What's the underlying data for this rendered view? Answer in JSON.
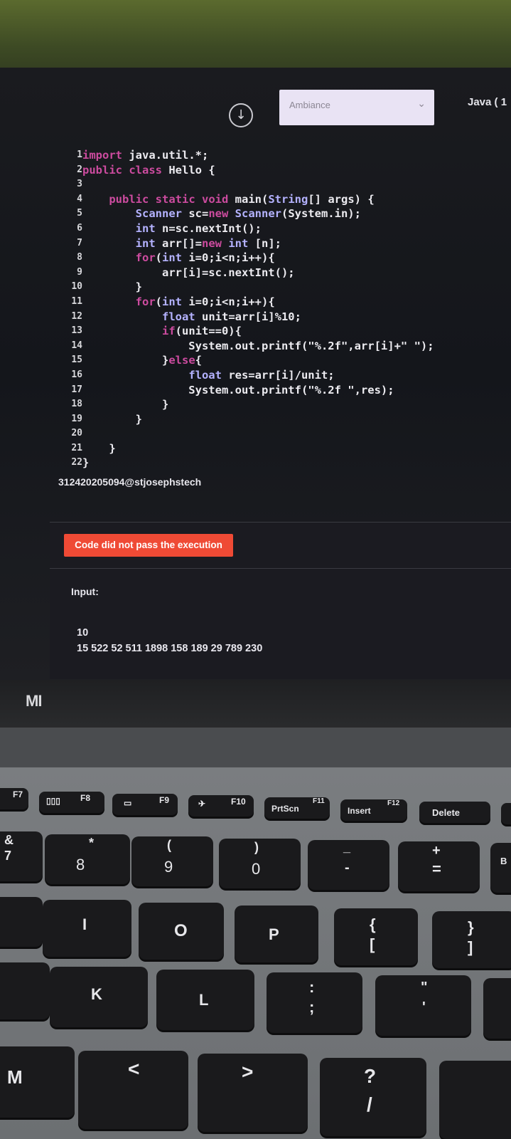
{
  "toolbar": {
    "theme_select_value": "Ambiance",
    "language_label": "Java ( 1"
  },
  "editor": {
    "lines": [
      {
        "n": "1",
        "text": "import java.util.*;"
      },
      {
        "n": "2",
        "text": "public class Hello {"
      },
      {
        "n": "3",
        "text": ""
      },
      {
        "n": "4",
        "text": "    public static void main(String[] args) {"
      },
      {
        "n": "5",
        "text": "        Scanner sc=new Scanner(System.in);"
      },
      {
        "n": "6",
        "text": "        int n=sc.nextInt();"
      },
      {
        "n": "7",
        "text": "        int arr[]=new int [n];"
      },
      {
        "n": "8",
        "text": "        for(int i=0;i<n;i++){"
      },
      {
        "n": "9",
        "text": "            arr[i]=sc.nextInt();"
      },
      {
        "n": "10",
        "text": "        }"
      },
      {
        "n": "11",
        "text": "        for(int i=0;i<n;i++){"
      },
      {
        "n": "12",
        "text": "            float unit=arr[i]%10;"
      },
      {
        "n": "13",
        "text": "            if(unit==0){"
      },
      {
        "n": "14",
        "text": "                System.out.printf(\"%.2f\",arr[i]+\" \");"
      },
      {
        "n": "15",
        "text": "            }else{"
      },
      {
        "n": "16",
        "text": "                float res=arr[i]/unit;"
      },
      {
        "n": "17",
        "text": "                System.out.printf(\"%.2f \",res);"
      },
      {
        "n": "18",
        "text": "            }"
      },
      {
        "n": "19",
        "text": "        }"
      },
      {
        "n": "20",
        "text": ""
      },
      {
        "n": "21",
        "text": "    }"
      },
      {
        "n": "22",
        "text": "}"
      }
    ],
    "cursor_glyph": "I"
  },
  "author": "312420205094@stjosephstech",
  "result": {
    "status_badge": "Code did not pass the execution",
    "input_label": "Input:",
    "input_lines": [
      "10",
      "15 522 52 511 1898 158 189 29 789 230"
    ]
  },
  "laptop": {
    "logo": "MI",
    "keys": {
      "f7": "F7",
      "f8": "F8",
      "f9": "F9",
      "f10": "F10",
      "f11": "F11",
      "f12": "F12",
      "prtscn": "PrtScn",
      "insert": "Insert",
      "delete": "Delete",
      "k8_top": "*",
      "k8_bottom": "8",
      "k9_top": "(",
      "k9_bottom": "9",
      "k0_top": ")",
      "k0_bottom": "0",
      "minus_top": "_",
      "minus_bottom": "-",
      "equals_top": "+",
      "equals_bottom": "=",
      "i": "I",
      "o": "O",
      "p": "P",
      "bracket_top": "{",
      "bracket_bottom": "[",
      "rbracket_top": "}",
      "rbracket_bottom": "]",
      "k": "K",
      "l": "L",
      "semicolon_top": ":",
      "semicolon_bottom": ";",
      "quote_top": "\"",
      "quote_bottom": "'",
      "m": "M",
      "comma_top": "<",
      "period_top": ">",
      "slash_top": "?",
      "slash_bottom": "/",
      "amp": "&",
      "seven": "7",
      "b": "B"
    }
  }
}
